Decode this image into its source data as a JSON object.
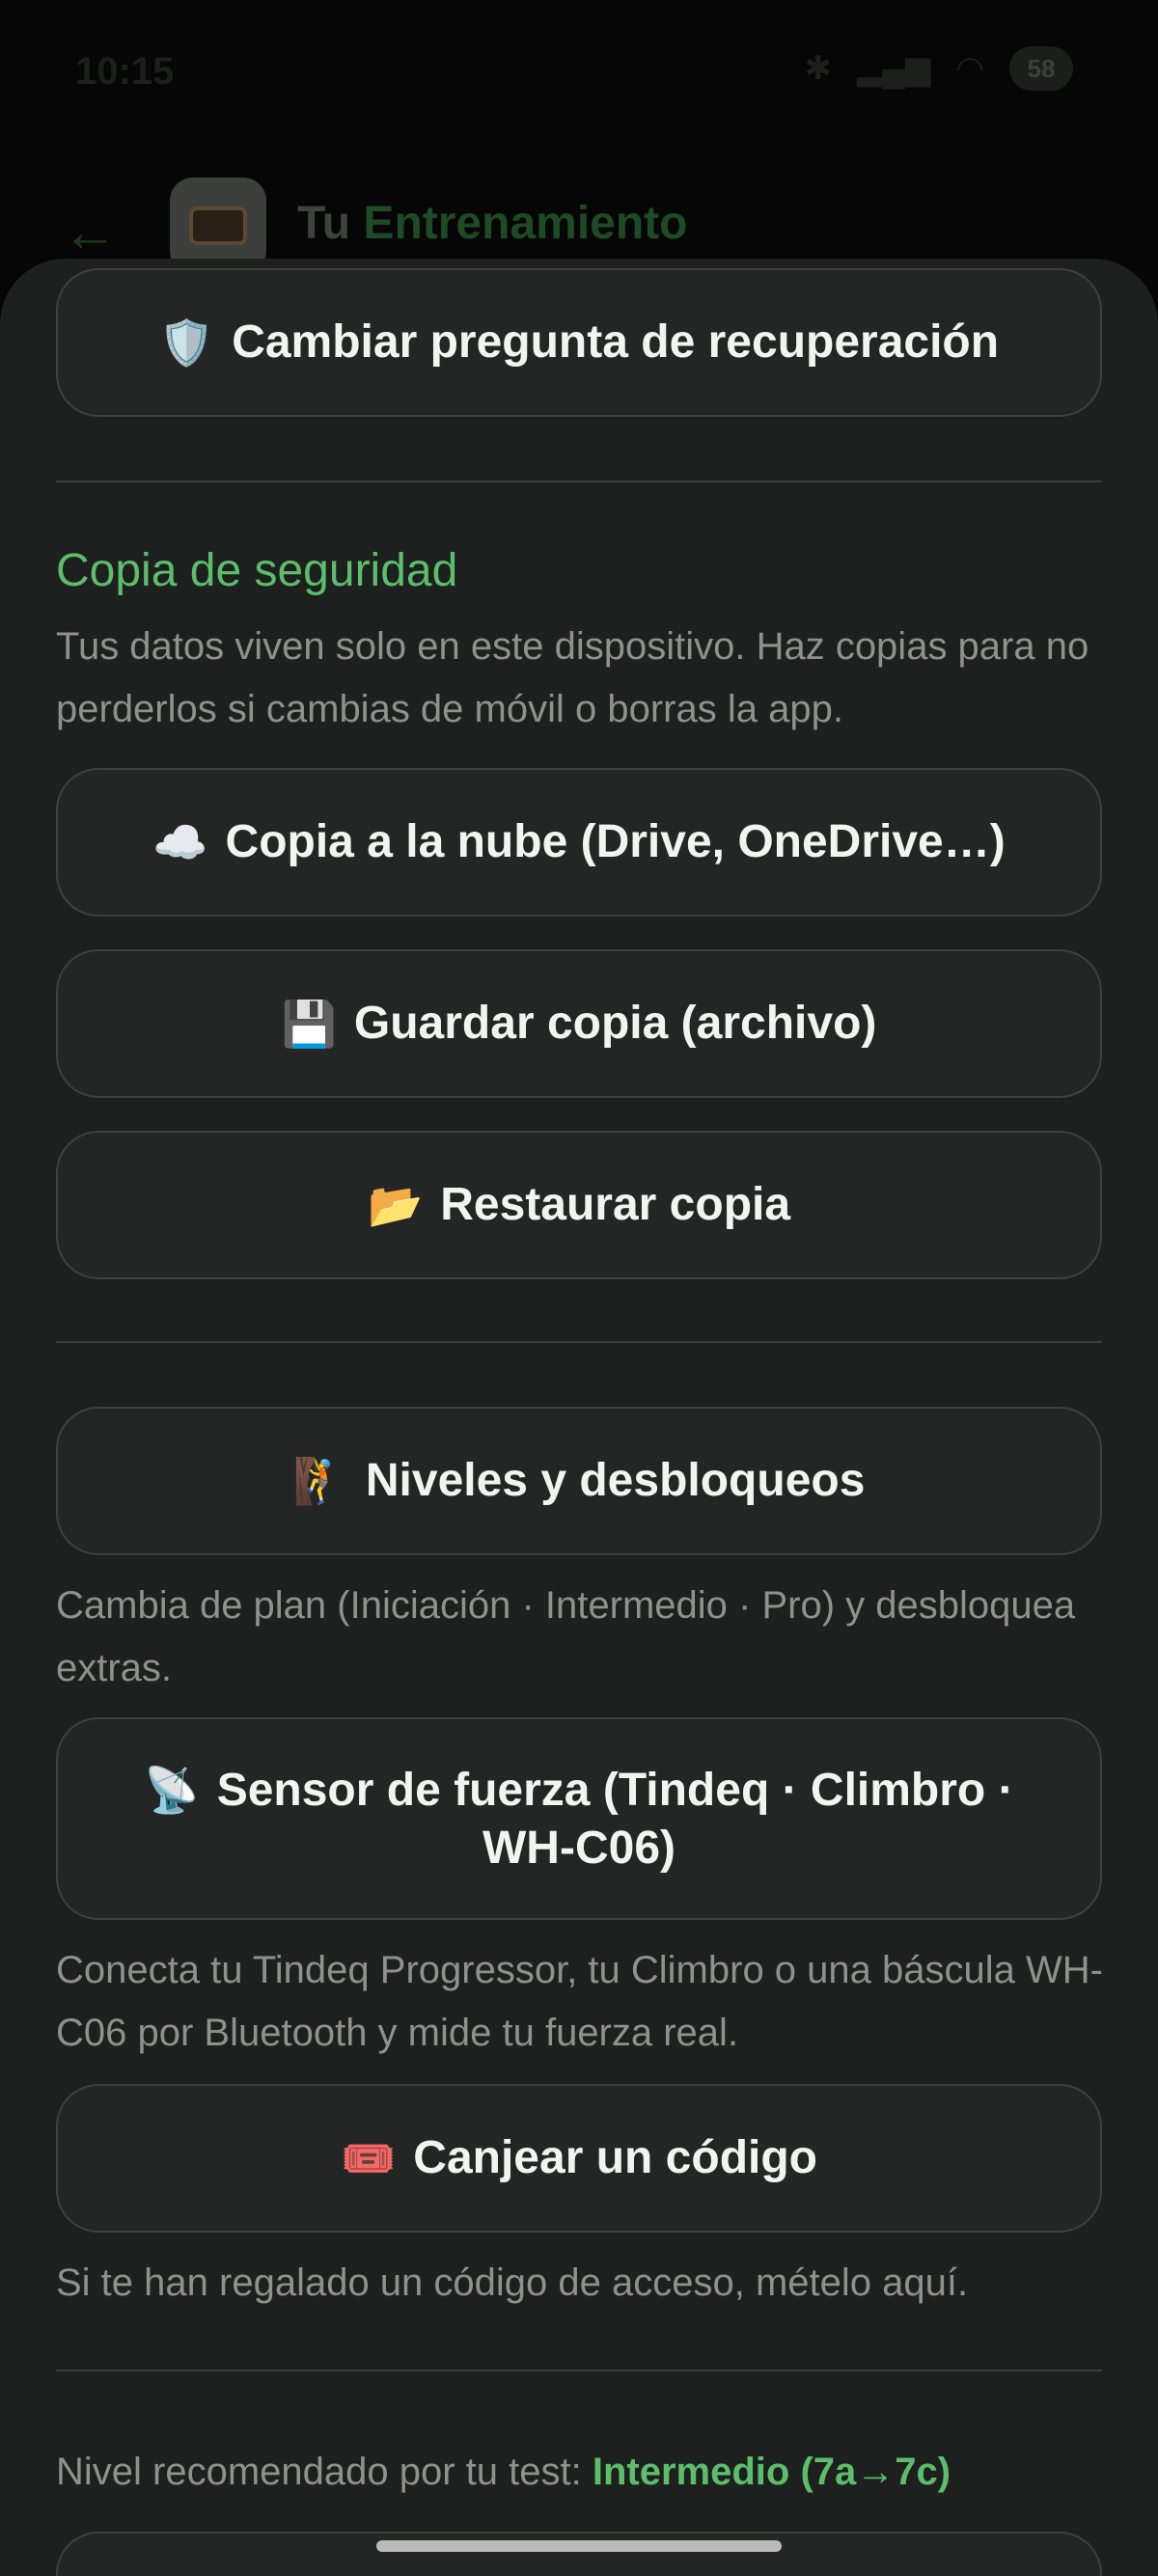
{
  "status_bar": {
    "time": "10:15",
    "battery": "58"
  },
  "header": {
    "title_prefix": "Tu",
    "title_accent": "Entrenamiento"
  },
  "sheet": {
    "recovery_button": {
      "icon": "🛡️",
      "label": "Cambiar pregunta de recuperación"
    },
    "backup": {
      "title": "Copia de seguridad",
      "description": "Tus datos viven solo en este dispositivo. Haz copias para no perderlos si cambias de móvil o borras la app.",
      "cloud_button": {
        "icon": "☁️",
        "label": "Copia a la nube (Drive, OneDrive…)"
      },
      "save_button": {
        "icon": "💾",
        "label": "Guardar copia (archivo)"
      },
      "restore_button": {
        "icon": "📂",
        "label": "Restaurar copia"
      }
    },
    "levels_button": {
      "icon": "🧗",
      "label": "Niveles y desbloqueos"
    },
    "levels_description": "Cambia de plan (Iniciación · Intermedio · Pro) y desbloquea extras.",
    "sensor_button": {
      "icon": "📡",
      "label": "Sensor de fuerza (Tindeq · Climbro · WH-C06)"
    },
    "sensor_description": "Conecta tu Tindeq Progressor, tu Climbro o una báscula WH-C06 por Bluetooth y mide tu fuerza real.",
    "redeem_button": {
      "icon": "🎟️",
      "label": "Canjear un código"
    },
    "redeem_description": "Si te han regalado un código de acceso, mételo aquí.",
    "recommended": {
      "prefix": "Nivel recomendado por tu test:",
      "value": "Intermedio (7a→7c)"
    }
  }
}
